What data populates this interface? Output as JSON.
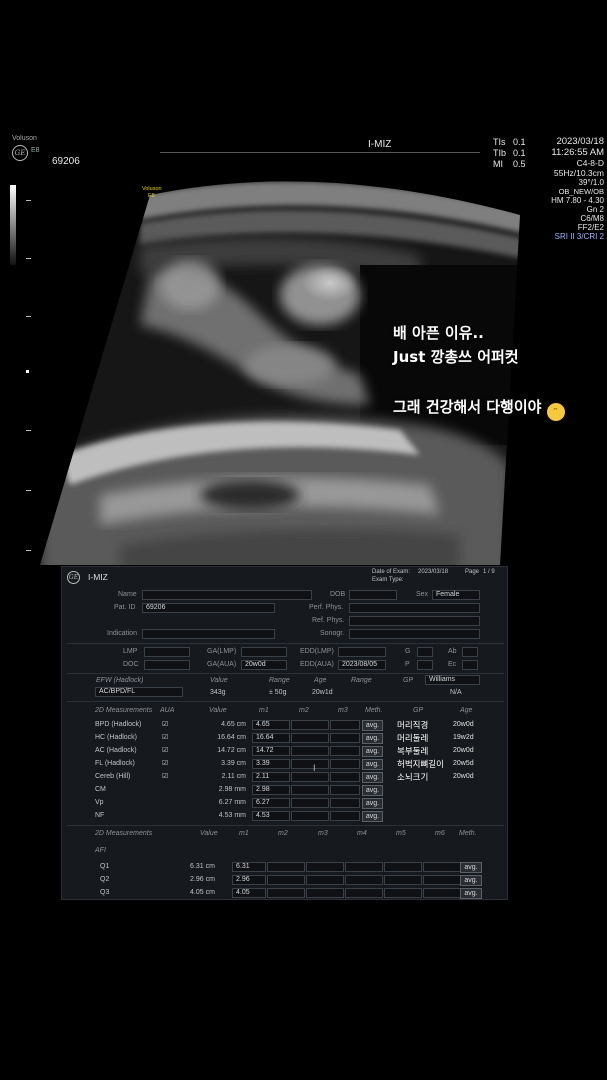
{
  "header": {
    "logo_brand": "Voluson",
    "logo_model": "E8",
    "patient_id": "69206",
    "title": "I-MIZ",
    "tis_label": "TIs",
    "tis_value": "0.1",
    "tib_label": "TIb",
    "tib_value": "0.1",
    "mi_label": "MI",
    "mi_value": "0.5",
    "date": "2023/03/18",
    "time": "11:26:55 AM",
    "probe": "C4-8-D",
    "params": [
      "55Hz/10.3cm",
      "39°/1.0",
      "OB_NEW/OB",
      "HM  7.80 - 4.30",
      "Gn  2",
      "C6/M8",
      "FF2/E2"
    ],
    "sri": "SRI II 3/CRI 2"
  },
  "scan": {
    "brand": "Voluson",
    "model": "E8"
  },
  "caption": {
    "line1": "배 아픈 이유..",
    "line2": "Just 깡총쓰 어퍼컷",
    "line3": "그래 건강해서 다행이야",
    "emoji": "😅"
  },
  "report": {
    "title": "I-MIZ",
    "date_label": "Date of Exam:",
    "date_value": "2023/03/18",
    "page_label": "Page",
    "page_value": "1 / 9",
    "exam_type_label": "Exam Type:",
    "name_label": "Name",
    "patid_label": "Pat. ID",
    "patid_value": "69206",
    "indication_label": "Indication",
    "dob_label": "DOB",
    "sex_label": "Sex",
    "sex_value": "Female",
    "perf_label": "Perf. Phys.",
    "ref_label": "Ref. Phys.",
    "sono_label": "Sonogr.",
    "lmp_label": "LMP",
    "doc_label": "DOC",
    "galmp_label": "GA(LMP)",
    "gaaua_label": "GA(AUA)",
    "gaaua_value": "20w0d",
    "eddlmp_label": "EDD(LMP)",
    "eddaua_label": "EDD(AUA)",
    "eddaua_value": "2023/08/05",
    "g_label": "G",
    "p_label": "P",
    "ab_label": "Ab",
    "ec_label": "Ec",
    "efw_label": "EFW (Hadlock)",
    "efw_formula": "AC/BPD/FL",
    "value_label": "Value",
    "range_label": "Range",
    "age_label": "Age",
    "gp_label": "GP",
    "efw_value": "343g",
    "efw_range": "± 50g",
    "efw_age": "20w1d",
    "gp_value": "Williams",
    "gp_na": "N/A",
    "meas_header": [
      "2D Measurements",
      "AUA",
      "Value",
      "m1",
      "m2",
      "m3",
      "Meth.",
      "GP",
      "Age"
    ],
    "measurements": [
      {
        "name": "BPD (Hadlock)",
        "aua": "☑",
        "value": "4.65 cm",
        "m1": "4.65",
        "meth": "avg.",
        "kor": "머리직경",
        "age": "20w0d"
      },
      {
        "name": "HC (Hadlock)",
        "aua": "☑",
        "value": "16.64 cm",
        "m1": "16.64",
        "meth": "avg.",
        "kor": "머리둘레",
        "age": "19w2d"
      },
      {
        "name": "AC (Hadlock)",
        "aua": "☑",
        "value": "14.72 cm",
        "m1": "14.72",
        "meth": "avg.",
        "kor": "복부둘레",
        "age": "20w0d"
      },
      {
        "name": "FL (Hadlock)",
        "aua": "☑",
        "value": "3.39 cm",
        "m1": "3.39",
        "meth": "avg.",
        "kor": "허벅지뼈길이",
        "age": "20w5d"
      },
      {
        "name": "Cereb (Hill)",
        "aua": "☑",
        "value": "2.11 cm",
        "m1": "2.11",
        "meth": "avg.",
        "kor": "소뇌크기",
        "age": "20w0d"
      },
      {
        "name": "CM",
        "aua": "",
        "value": "2.98 mm",
        "m1": "2.98",
        "meth": "avg.",
        "kor": "",
        "age": ""
      },
      {
        "name": "Vp",
        "aua": "",
        "value": "6.27 mm",
        "m1": "6.27",
        "meth": "avg.",
        "kor": "",
        "age": ""
      },
      {
        "name": "NF",
        "aua": "",
        "value": "4.53 mm",
        "m1": "4.53",
        "meth": "avg.",
        "kor": "",
        "age": ""
      }
    ],
    "afi_header": [
      "2D Measurements",
      "Value",
      "m1",
      "m2",
      "m3",
      "m4",
      "m5",
      "m6",
      "Meth."
    ],
    "afi_label": "AFI",
    "afi": [
      {
        "name": "Q1",
        "value": "6.31  cm",
        "m1": "6.31",
        "meth": "avg."
      },
      {
        "name": "Q2",
        "value": "2.96  cm",
        "m1": "2.96",
        "meth": "avg."
      },
      {
        "name": "Q3",
        "value": "4.05  cm",
        "m1": "4.05",
        "meth": "avg."
      }
    ],
    "cursor": "I"
  }
}
